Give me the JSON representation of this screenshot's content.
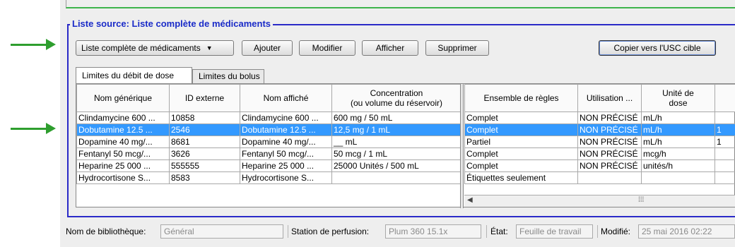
{
  "group_title": "Liste source: Liste complète de médicaments",
  "toolbar": {
    "list_select": "Liste complète de médicaments",
    "add": "Ajouter",
    "modify": "Modifier",
    "show": "Afficher",
    "delete": "Supprimer",
    "copy": "Copier vers l'USC cible"
  },
  "tabs": [
    {
      "label": "Limites du débit de dose"
    },
    {
      "label": "Limites du bolus"
    }
  ],
  "left_table": {
    "headers": [
      "Nom générique",
      "ID externe",
      "Nom affiché",
      "Concentration",
      "(ou volume du réservoir)"
    ],
    "rows": [
      [
        "Clindamycine 600 ...",
        "10858",
        "Clindamycine 600 ...",
        "600 mg / 50 mL"
      ],
      [
        "Dobutamine 12.5 ...",
        "2546",
        "Dobutamine 12.5 ...",
        "12,5 mg / 1 mL"
      ],
      [
        "Dopamine 40 mg/...",
        "8681",
        "Dopamine 40 mg/...",
        "__ mL"
      ],
      [
        "Fentanyl 50 mcg/...",
        "3626",
        "Fentanyl 50 mcg/...",
        "50 mcg / 1 mL"
      ],
      [
        "Heparine 25 000 ...",
        "555555",
        "Heparine 25 000 ...",
        "25000 Unités / 500 mL"
      ],
      [
        "Hydrocortisone S...",
        "8583",
        "Hydrocortisone S...",
        ""
      ]
    ]
  },
  "right_table": {
    "headers": [
      "Ensemble de règles",
      "Utilisation ...",
      "Unité de",
      "dose",
      ""
    ],
    "rows": [
      [
        "Complet",
        "NON PRÉCISÉ",
        "mL/h",
        ""
      ],
      [
        "Complet",
        "NON PRÉCISÉ",
        "mL/h",
        "1"
      ],
      [
        "Partiel",
        "NON PRÉCISÉ",
        "mL/h",
        "1"
      ],
      [
        "Complet",
        "NON PRÉCISÉ",
        "mcg/h",
        ""
      ],
      [
        "Complet",
        "NON PRÉCISÉ",
        "unités/h",
        ""
      ],
      [
        "Étiquettes seulement",
        "",
        "",
        ""
      ]
    ]
  },
  "selected_row": 1,
  "status": {
    "library_label": "Nom de bibliothèque:",
    "library_value": "Général",
    "station_label": "Station de perfusion:",
    "station_value": "Plum 360 15.1x",
    "state_label": "État:",
    "state_value": "Feuille de travail",
    "modified_label": "Modifié:",
    "modified_value": "25 mai 2016 02:22"
  },
  "colors": {
    "group_border": "#2a2ac8",
    "selection": "#3399ff",
    "pointer_arrow": "#2e9e2e"
  },
  "icons": {
    "dropdown": "chevron-down-icon",
    "hscroll_left": "arrow-left-icon"
  }
}
